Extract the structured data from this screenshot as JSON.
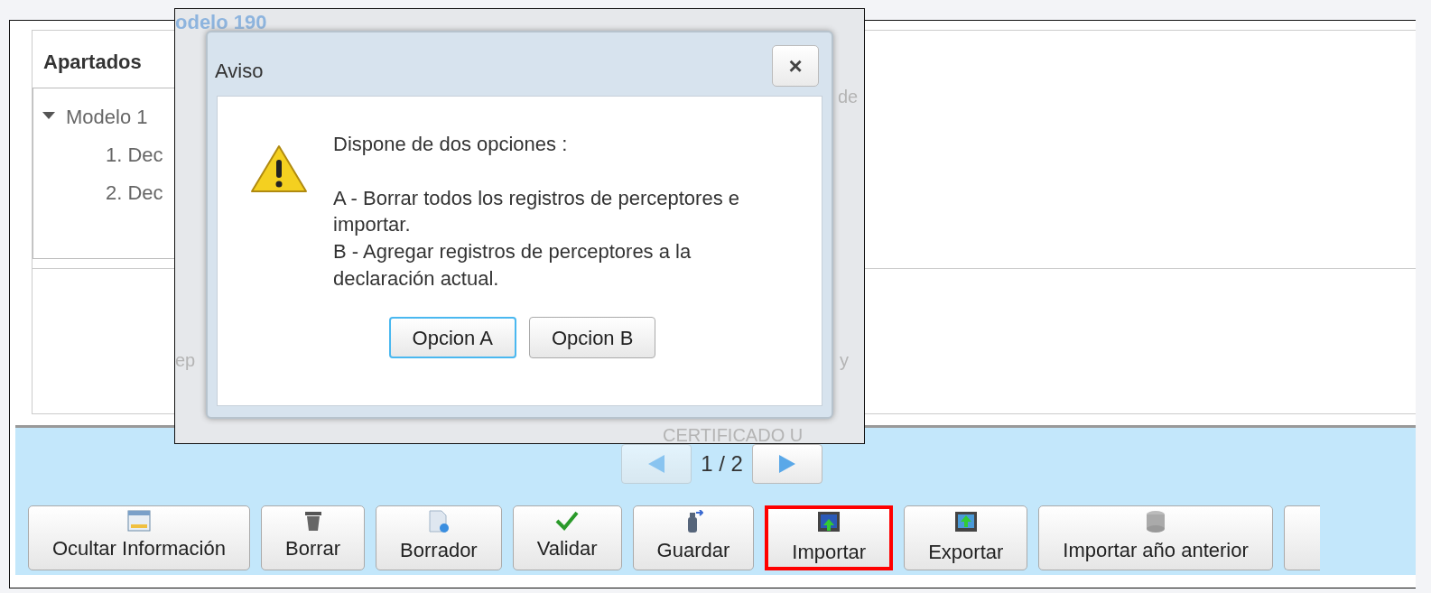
{
  "panel": {
    "title": "Apartados",
    "tree": [
      {
        "label": "Modelo 1",
        "expanded": true,
        "children": [
          {
            "label": "1. Dec"
          },
          {
            "label": "2. Dec"
          }
        ]
      }
    ]
  },
  "pager": {
    "current": "1",
    "separator": "/",
    "total": "2"
  },
  "toolbar": [
    {
      "label": "Ocultar Información",
      "highlighted": false
    },
    {
      "label": "Borrar",
      "highlighted": false
    },
    {
      "label": "Borrador",
      "highlighted": false
    },
    {
      "label": "Validar",
      "highlighted": false
    },
    {
      "label": "Guardar",
      "highlighted": false
    },
    {
      "label": "Importar",
      "highlighted": true
    },
    {
      "label": "Exportar",
      "highlighted": false
    },
    {
      "label": "Importar año anterior",
      "highlighted": false
    }
  ],
  "inset": {
    "heading": "odelo 190",
    "faint_texts": [
      "de",
      "ep",
      "y",
      "CERTIFICADO U"
    ],
    "dialog": {
      "title": "Aviso",
      "close": "×",
      "intro": "Dispone de dos opciones :",
      "lines": [
        "A - Borrar todos los registros de perceptores e importar.",
        "B - Agregar registros de perceptores a la declaración actual."
      ],
      "buttons": [
        {
          "label": "Opcion A",
          "focused": true
        },
        {
          "label": "Opcion B",
          "focused": false
        }
      ]
    }
  }
}
